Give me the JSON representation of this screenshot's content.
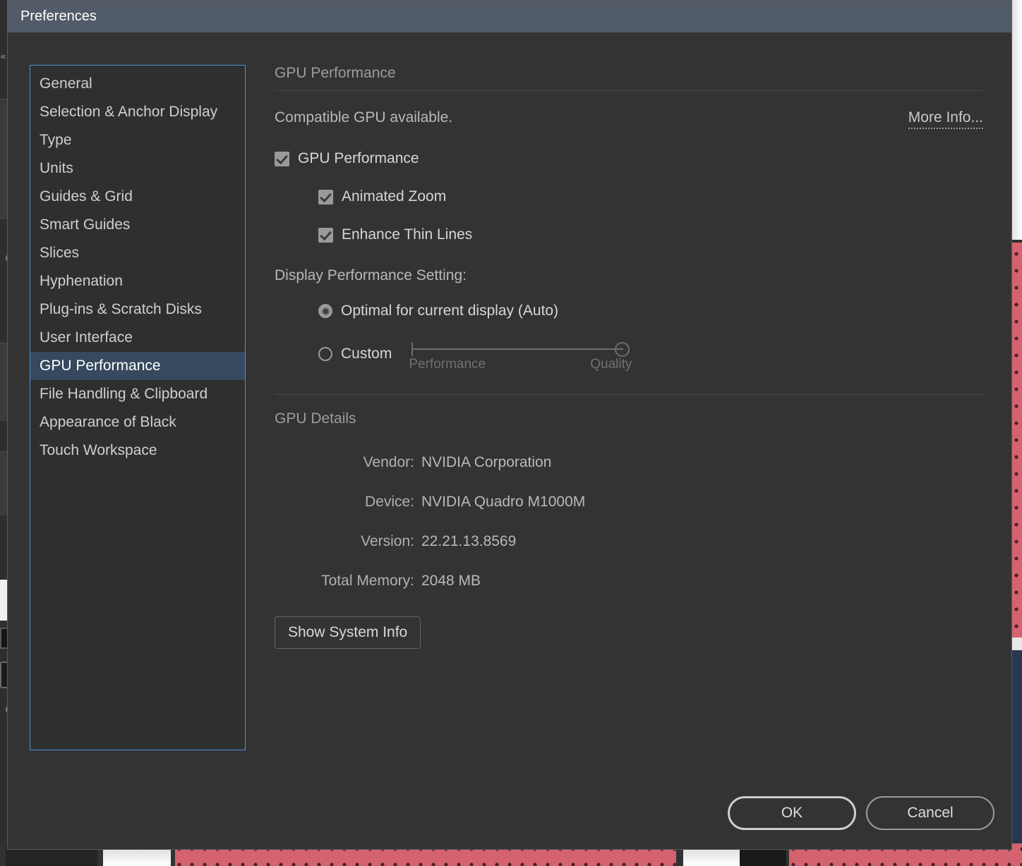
{
  "background": {
    "collapse_chevrons": "«"
  },
  "dialog": {
    "title": "Preferences"
  },
  "sidebar": {
    "items": [
      {
        "label": "General",
        "selected": false
      },
      {
        "label": "Selection & Anchor Display",
        "selected": false
      },
      {
        "label": "Type",
        "selected": false
      },
      {
        "label": "Units",
        "selected": false
      },
      {
        "label": "Guides & Grid",
        "selected": false
      },
      {
        "label": "Smart Guides",
        "selected": false
      },
      {
        "label": "Slices",
        "selected": false
      },
      {
        "label": "Hyphenation",
        "selected": false
      },
      {
        "label": "Plug-ins & Scratch Disks",
        "selected": false
      },
      {
        "label": "User Interface",
        "selected": false
      },
      {
        "label": "GPU Performance",
        "selected": true
      },
      {
        "label": "File Handling & Clipboard",
        "selected": false
      },
      {
        "label": "Appearance of Black",
        "selected": false
      },
      {
        "label": "Touch Workspace",
        "selected": false
      }
    ]
  },
  "main": {
    "header": "GPU Performance",
    "status_text": "Compatible GPU available.",
    "more_info_label": "More Info...",
    "checkboxes": [
      {
        "label": "GPU Performance",
        "checked": true,
        "indent": false
      },
      {
        "label": "Animated Zoom",
        "checked": true,
        "indent": true
      },
      {
        "label": "Enhance Thin Lines",
        "checked": true,
        "indent": true
      }
    ],
    "display_performance_label": "Display Performance Setting:",
    "radios": [
      {
        "label": "Optimal for current display (Auto)",
        "checked": true
      },
      {
        "label": "Custom",
        "checked": false
      }
    ],
    "slider": {
      "min_label": "Performance",
      "max_label": "Quality",
      "value_percent": 100
    },
    "gpu_details_header": "GPU Details",
    "details": [
      {
        "label": "Vendor:",
        "value": "NVIDIA Corporation"
      },
      {
        "label": "Device:",
        "value": "NVIDIA Quadro M1000M"
      },
      {
        "label": "Version:",
        "value": "22.21.13.8569"
      },
      {
        "label": "Total Memory:",
        "value": "2048 MB"
      }
    ],
    "show_system_info_label": "Show System Info"
  },
  "footer": {
    "ok_label": "OK",
    "cancel_label": "Cancel"
  },
  "colors": {
    "titlebar": "#525b68",
    "dialog_bg": "#333333",
    "list_border": "#4a90d9",
    "selection": "#36495e",
    "accent_art": "#d4626f"
  }
}
